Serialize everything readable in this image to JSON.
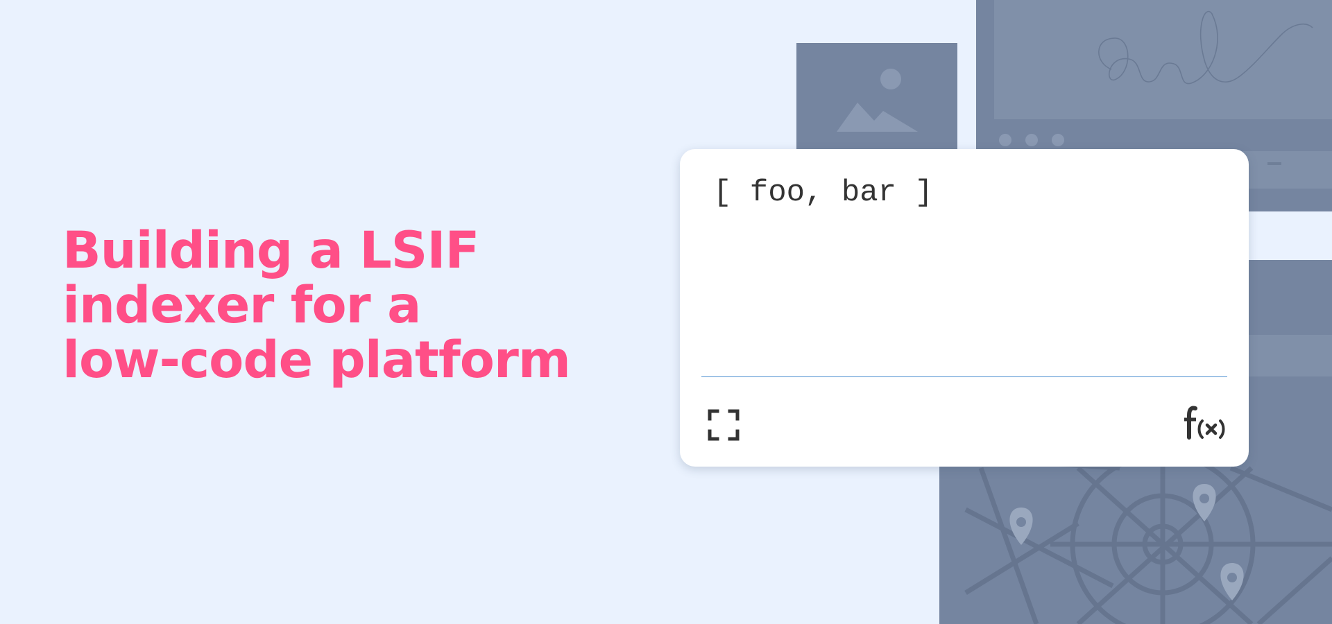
{
  "headline": {
    "line1": "Building a LSIF",
    "line2": "indexer for a",
    "line3": "low-code platform"
  },
  "editor": {
    "code": "[ foo, bar ]"
  },
  "icons": {
    "expand": "expand-icon",
    "function": "function-fx-icon",
    "image_placeholder": "image-icon",
    "signature": "signature-icon",
    "map": "map-icon",
    "map_pin": "map-pin-icon"
  },
  "colors": {
    "background": "#eaf2fe",
    "headline": "#ff4f87",
    "panel": "#7585a0",
    "card": "#ffffff",
    "divider": "#4d8fd0",
    "code_text": "#333333"
  }
}
